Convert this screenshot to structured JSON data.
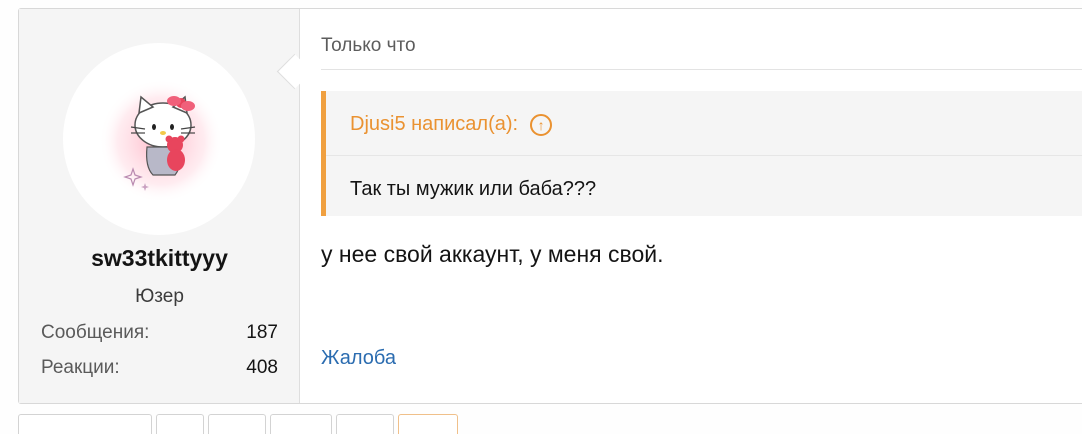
{
  "post": {
    "user": {
      "name": "sw33tkittyyy",
      "title": "Юзер",
      "avatar_icon": "hello-kitty-avatar-icon",
      "stats": [
        {
          "label": "Сообщения:",
          "value": "187"
        },
        {
          "label": "Реакции:",
          "value": "408"
        }
      ]
    },
    "timestamp": "Только что",
    "quote": {
      "author_line": "Djusi5 написал(а):",
      "jump_icon": "arrow-up-circle-icon",
      "text": "Так ты мужик или баба???"
    },
    "message": "у нее свой аккаунт, у меня свой.",
    "report_link": "Жалоба",
    "colors": {
      "quote_accent": "#ea9231",
      "link": "#2b6cb0"
    }
  }
}
